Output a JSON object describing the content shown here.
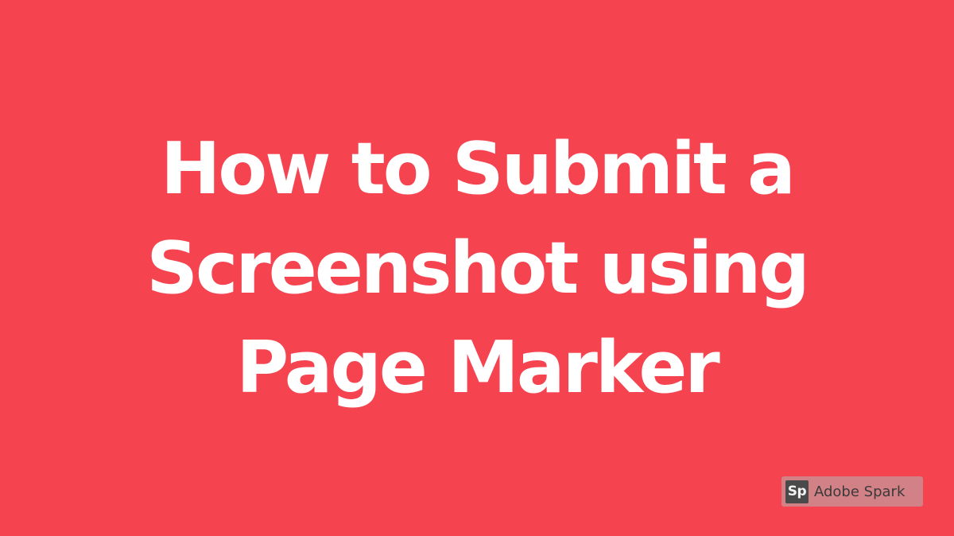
{
  "slide": {
    "title_lines": [
      "How to Submit a",
      "Screenshot using",
      "Page Marker"
    ],
    "background_color": "#f54450",
    "text_color": "#ffffff"
  },
  "watermark": {
    "logo_text": "Sp",
    "brand_name": "Adobe Spark"
  }
}
